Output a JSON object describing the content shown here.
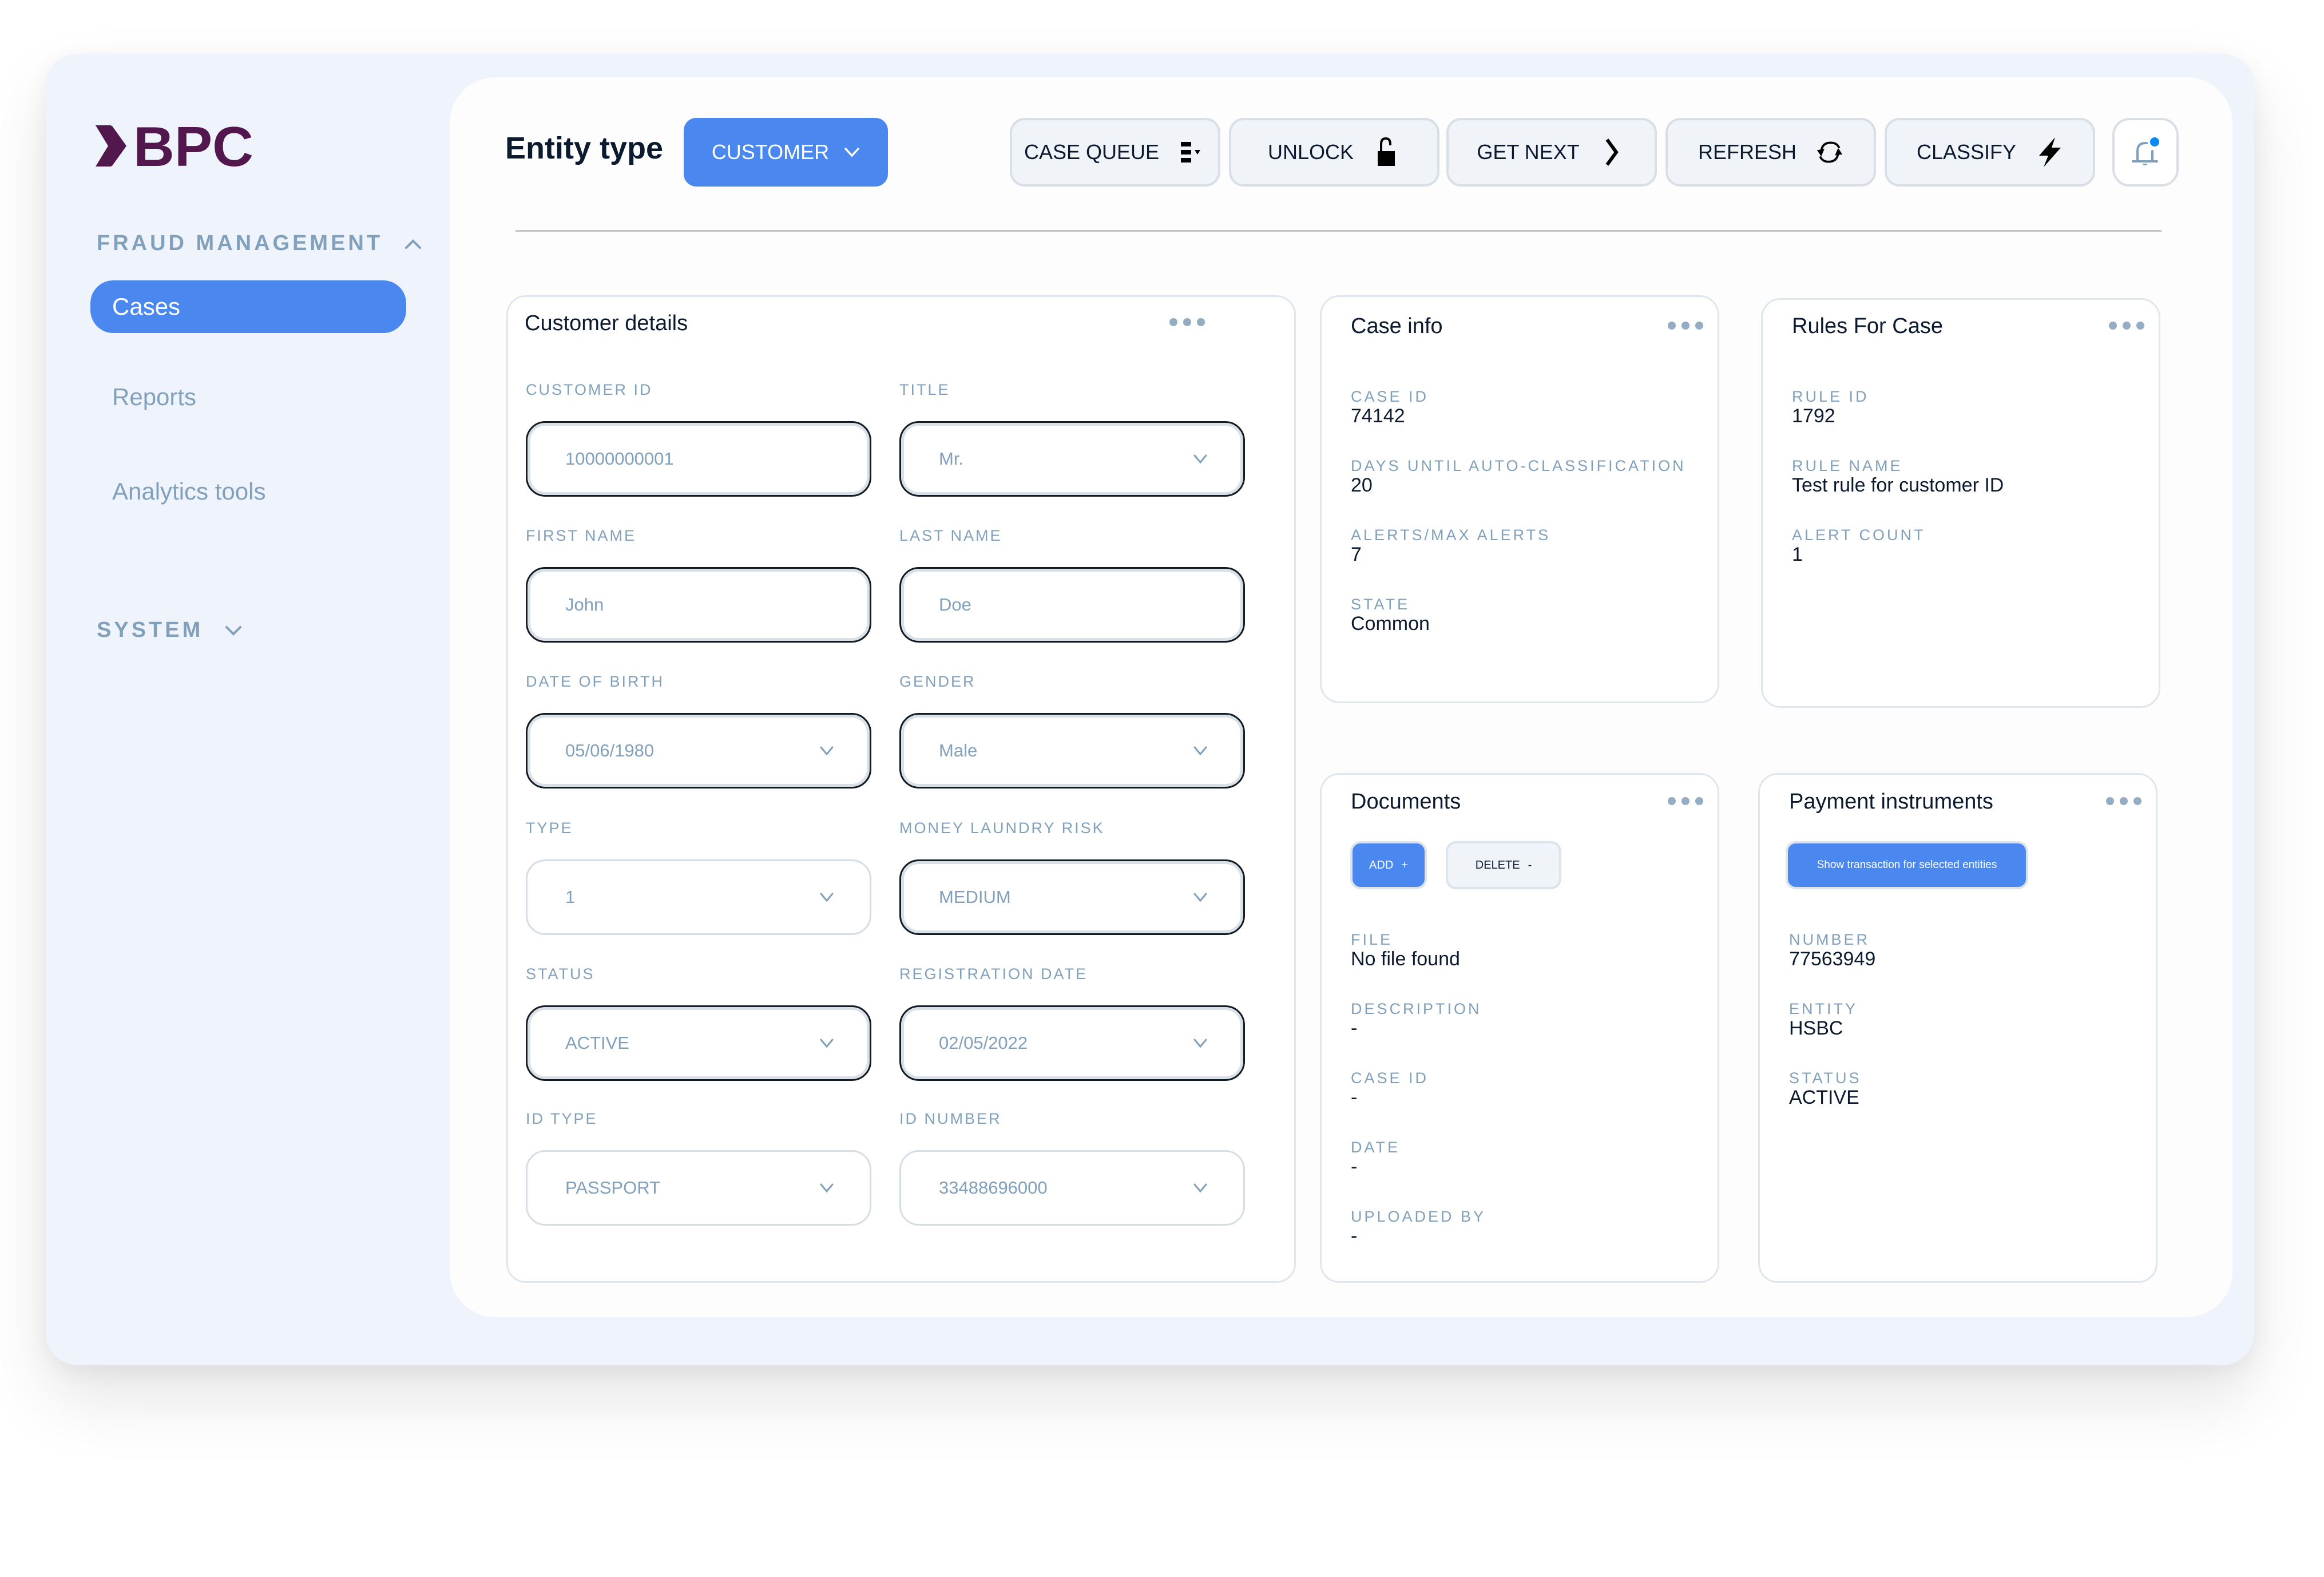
{
  "brand": {
    "logo_text": "BPC",
    "logo_color": "#52184e"
  },
  "colors": {
    "accent": "#4a88f0",
    "muted": "#80a0bb",
    "frame_bg": "#eff3fb",
    "notification_dot": "#0a8af5"
  },
  "sidebar": {
    "sections": [
      {
        "label": "FRAUD MANAGEMENT",
        "expanded": true,
        "items": [
          {
            "label": "Cases",
            "active": true
          },
          {
            "label": "Reports",
            "active": false
          },
          {
            "label": "Analytics tools",
            "active": false
          }
        ]
      },
      {
        "label": "SYSTEM",
        "expanded": false,
        "items": []
      }
    ]
  },
  "header": {
    "entity_type_label": "Entity type",
    "entity_type_value": "CUSTOMER",
    "toolbar": [
      {
        "label": "CASE QUEUE",
        "icon": "queue-list-icon"
      },
      {
        "label": "UNLOCK",
        "icon": "unlock-icon"
      },
      {
        "label": "GET NEXT",
        "icon": "chevron-right-icon"
      },
      {
        "label": "REFRESH",
        "icon": "refresh-icon"
      },
      {
        "label": "CLASSIFY",
        "icon": "lightning-icon"
      }
    ],
    "notifications_icon": "bell-icon",
    "has_unread_notifications": true
  },
  "customer_details": {
    "title": "Customer details",
    "fields": [
      {
        "label": "CUSTOMER ID",
        "value": "10000000001",
        "type": "text"
      },
      {
        "label": "TITLE",
        "value": "Mr.",
        "type": "select"
      },
      {
        "label": "FIRST NAME",
        "value": "John",
        "type": "text"
      },
      {
        "label": "LAST NAME",
        "value": "Doe",
        "type": "text"
      },
      {
        "label": "DATE OF BIRTH",
        "value": "05/06/1980",
        "type": "select"
      },
      {
        "label": "GENDER",
        "value": "Male",
        "type": "select"
      },
      {
        "label": "TYPE",
        "value": "1",
        "type": "select"
      },
      {
        "label": "MONEY LAUNDRY RISK",
        "value": "MEDIUM",
        "type": "select"
      },
      {
        "label": "STATUS",
        "value": "ACTIVE",
        "type": "select"
      },
      {
        "label": "REGISTRATION DATE",
        "value": "02/05/2022",
        "type": "select"
      },
      {
        "label": "ID TYPE",
        "value": "PASSPORT",
        "type": "select"
      },
      {
        "label": "ID NUMBER",
        "value": "33488696000",
        "type": "select"
      }
    ]
  },
  "case_info": {
    "title": "Case info",
    "items": [
      {
        "label": "CASE ID",
        "value": "74142"
      },
      {
        "label": "DAYS UNTIL AUTO-CLASSIFICATION",
        "value": "20"
      },
      {
        "label": "ALERTS/MAX ALERTS",
        "value": "7"
      },
      {
        "label": "STATE",
        "value": "Common"
      }
    ]
  },
  "rules_for_case": {
    "title": "Rules For Case",
    "items": [
      {
        "label": "RULE ID",
        "value": "1792"
      },
      {
        "label": "RULE NAME",
        "value": "Test rule for customer ID"
      },
      {
        "label": "ALERT COUNT",
        "value": "1"
      }
    ]
  },
  "documents": {
    "title": "Documents",
    "add_label": "ADD",
    "add_symbol": "+",
    "delete_label": "DELETE",
    "delete_symbol": "-",
    "items": [
      {
        "label": "FILE",
        "value": "No file found"
      },
      {
        "label": "DESCRIPTION",
        "value": "-"
      },
      {
        "label": "CASE ID",
        "value": "-"
      },
      {
        "label": "DATE",
        "value": "-"
      },
      {
        "label": "UPLOADED BY",
        "value": "-"
      }
    ]
  },
  "payment_instruments": {
    "title": "Payment instruments",
    "show_button_label": "Show transaction for selected entities",
    "items": [
      {
        "label": "NUMBER",
        "value": "77563949"
      },
      {
        "label": "ENTITY",
        "value": "HSBC"
      },
      {
        "label": "STATUS",
        "value": "ACTIVE"
      }
    ]
  }
}
